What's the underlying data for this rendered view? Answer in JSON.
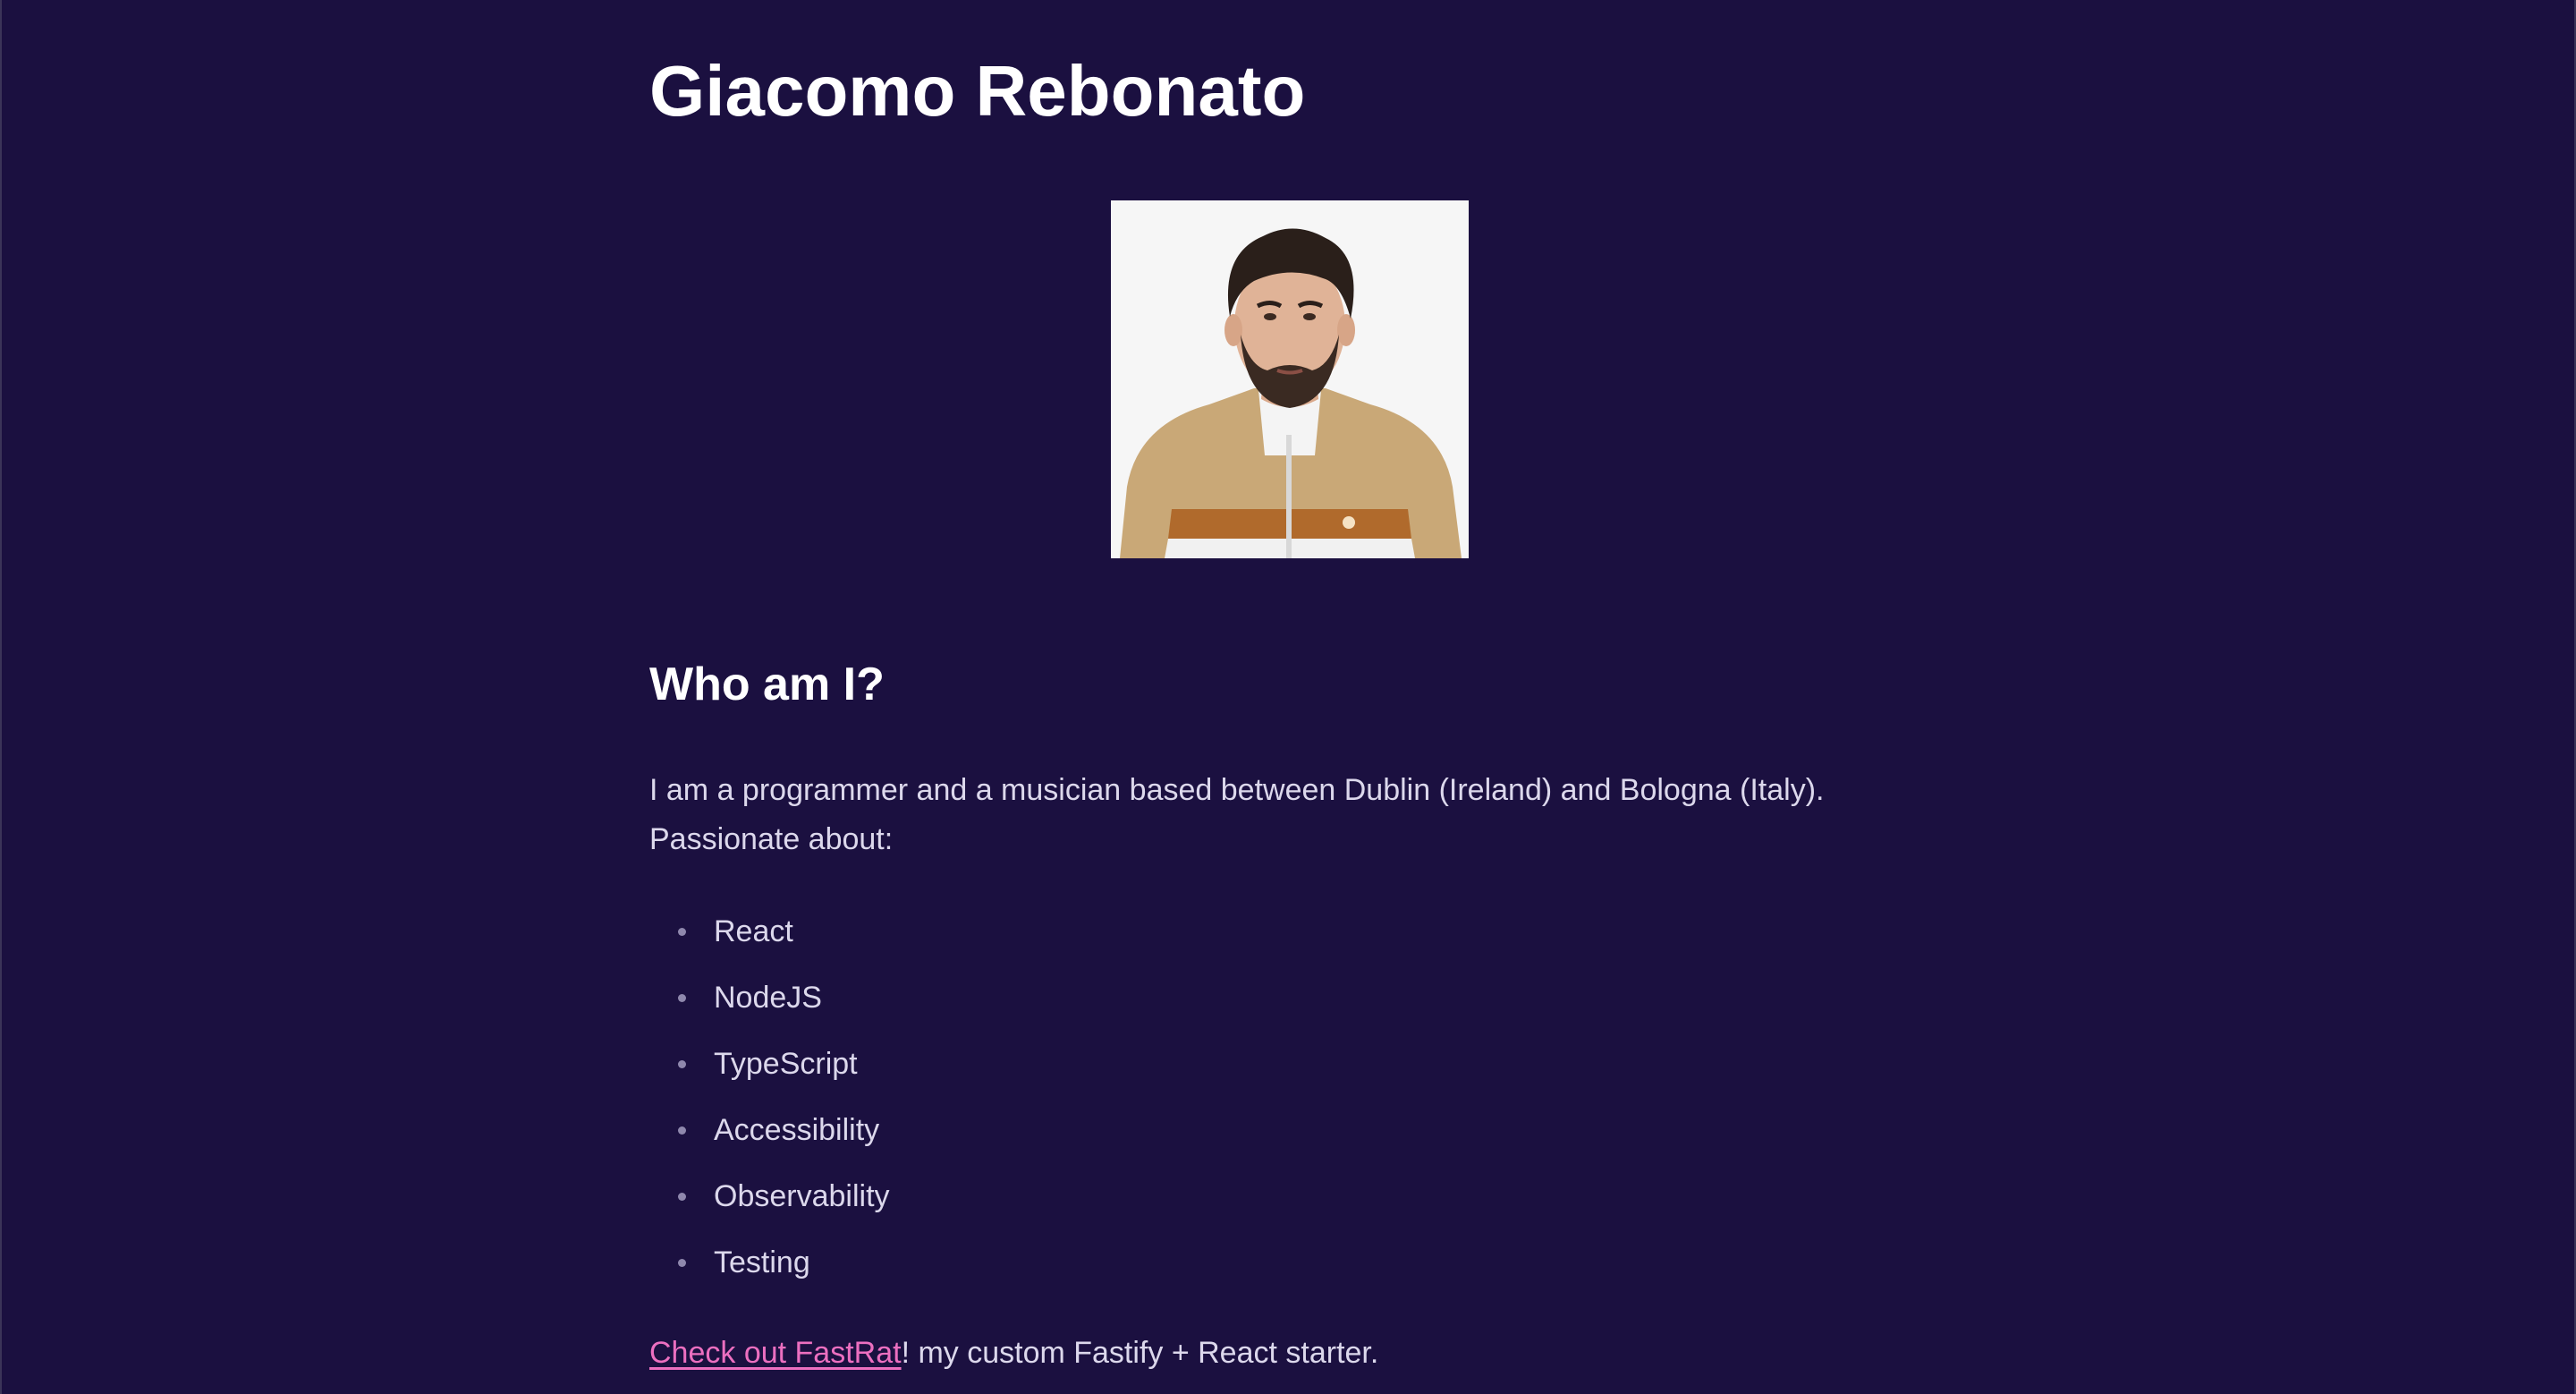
{
  "header": {
    "title": "Giacomo Rebonato"
  },
  "profile": {
    "avatar_icon": "profile-photo"
  },
  "about": {
    "heading": "Who am I?",
    "intro_line1": "I am a programmer and a musician based between Dublin (Ireland) and Bologna (Italy).",
    "intro_line2": "Passionate about:",
    "interests": [
      {
        "label": "React"
      },
      {
        "label": "NodeJS"
      },
      {
        "label": "TypeScript"
      },
      {
        "label": "Accessibility"
      },
      {
        "label": "Observability"
      },
      {
        "label": "Testing"
      }
    ]
  },
  "footer": {
    "link_label": "Check out FastRat",
    "trailing_text": "! my custom Fastify + React starter."
  },
  "colors": {
    "background": "#1b1040",
    "heading": "#ffffff",
    "body_text": "#dcd8ec",
    "link": "#ec6fc0"
  }
}
